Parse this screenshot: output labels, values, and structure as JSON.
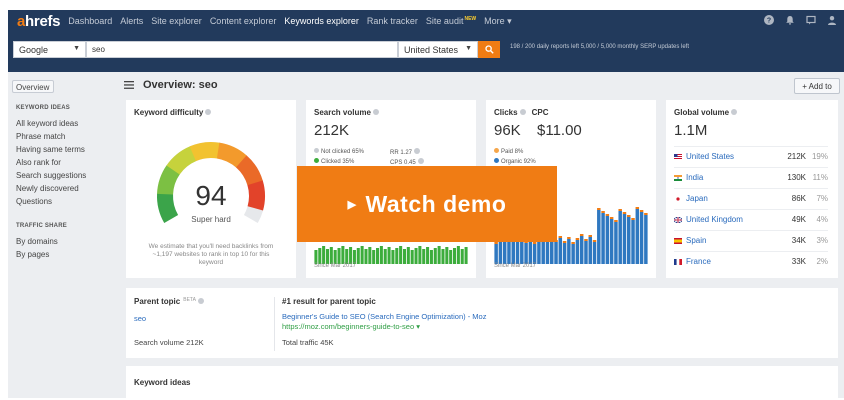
{
  "nav": {
    "logo_a": "a",
    "logo_rest": "hrefs",
    "items": [
      "Dashboard",
      "Alerts",
      "Site explorer",
      "Content explorer",
      "Keywords explorer",
      "Rank tracker",
      "Site audit",
      "More ▾"
    ],
    "new_badge": "NEW"
  },
  "search": {
    "engine": "Google",
    "query": "seo",
    "country": "United States",
    "limits": "198 / 200 daily reports left   5,000 / 5,000 monthly SERP updates left"
  },
  "sidebar": {
    "overview": "Overview",
    "keyword_ideas_head": "KEYWORD IDEAS",
    "keyword_ideas": [
      "All keyword ideas",
      "Phrase match",
      "Having same terms",
      "Also rank for",
      "Search suggestions",
      "Newly discovered",
      "Questions"
    ],
    "traffic_share_head": "TRAFFIC SHARE",
    "traffic_share": [
      "By domains",
      "By pages"
    ]
  },
  "main": {
    "title": "Overview: seo",
    "add_to": "+ Add to"
  },
  "kd": {
    "title": "Keyword difficulty",
    "value": "94",
    "label": "Super hard",
    "note": "We estimate that you'll need backlinks from ~1,197 websites to rank in top 10 for this keyword",
    "fraction": 0.94
  },
  "volume": {
    "title": "Search volume",
    "value": "212K",
    "not_clicked": "Not clicked 65%",
    "clicked": "Clicked 35%",
    "rr": "RR 1.27",
    "cps": "CPS 0.45",
    "since": "Since Mar 2017"
  },
  "clicks": {
    "title_clicks": "Clicks",
    "title_cpc": "CPC",
    "clicks_value": "96K",
    "cpc_value": "$11.00",
    "paid": "Paid 8%",
    "organic": "Organic 92%",
    "since": "Since Mar 2017"
  },
  "global": {
    "title": "Global volume",
    "value": "1.1M",
    "rows": [
      {
        "country": "United States",
        "volume": "212K",
        "pct": "19%"
      },
      {
        "country": "India",
        "volume": "130K",
        "pct": "11%"
      },
      {
        "country": "Japan",
        "volume": "86K",
        "pct": "7%"
      },
      {
        "country": "United Kingdom",
        "volume": "49K",
        "pct": "4%"
      },
      {
        "country": "Spain",
        "volume": "34K",
        "pct": "3%"
      },
      {
        "country": "France",
        "volume": "33K",
        "pct": "2%"
      }
    ]
  },
  "parent": {
    "title": "Parent topic",
    "beta": "BETA",
    "topic": "seo",
    "search_volume": "Search volume 212K",
    "result_head": "#1 result for parent topic",
    "result_title": "Beginner's Guide to SEO (Search Engine Optimization) - Moz",
    "result_url": "https://moz.com/beginners-guide-to-seo ▾",
    "traffic": "Total traffic 45K"
  },
  "ideas": {
    "title": "Keyword ideas"
  },
  "overlay": {
    "watch_demo": "Watch demo"
  },
  "colors": {
    "nav_bg": "#223a5c",
    "accent": "#f07c14",
    "link": "#2a6bbd",
    "green": "#3cad3c",
    "blue_bar": "#2f78c0",
    "orange_bar": "#f07c14"
  }
}
